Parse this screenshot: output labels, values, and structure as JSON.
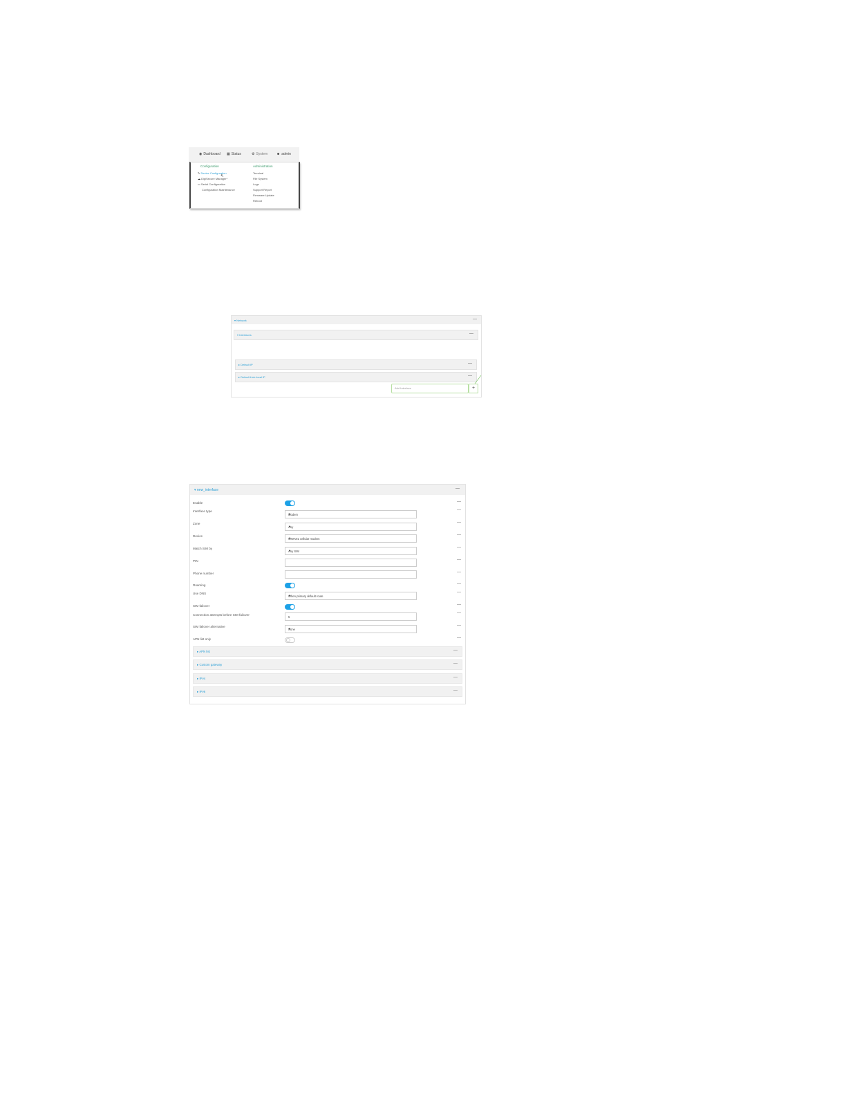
{
  "menu": {
    "nav": {
      "dashboard": "Dashboard",
      "status": "Status",
      "system": "System",
      "admin": "admin"
    },
    "configuration": {
      "heading": "Configuration",
      "items": [
        "Device Configuration",
        "DigiSecure Manager*",
        "Serial Configuration",
        "Configuration Maintenance"
      ]
    },
    "administration": {
      "heading": "Administration",
      "items": [
        "Terminal",
        "File System",
        "Logs",
        "Support Report",
        "Firmware Update",
        "Reboot"
      ]
    }
  },
  "interfaces": {
    "network": "Network",
    "interfaces": "Interfaces",
    "default_ip": "Default IP",
    "default_linklocal_ip": "Default Link-local IP",
    "add_placeholder": "Add Interface",
    "add_button": "+"
  },
  "form": {
    "title": "new_interface",
    "dash": "—",
    "fields": {
      "enable": "Enable",
      "interface_type": "Interface type",
      "interface_type_value": "Modem",
      "zone": "Zone",
      "zone_value": "Any",
      "device": "Device",
      "device_value": "WWAN1 cellular modem",
      "match_sim_by": "Match SIM by",
      "match_sim_value": "Any SIM",
      "pin": "PIN",
      "phone_number": "Phone number",
      "roaming": "Roaming",
      "use_dns": "Use DNS",
      "use_dns_value": "When primary default route",
      "sim_failover": "SIM failover",
      "connection_attempts": "Connection attempts before SIM failover",
      "connection_attempts_value": "5",
      "sim_failover_alternative": "SIM failover alternative",
      "sim_failover_alternative_value": "None",
      "apn_list_only": "APN list only"
    },
    "sections": [
      "APN list",
      "Custom gateway",
      "IPv4",
      "IPv6"
    ]
  }
}
